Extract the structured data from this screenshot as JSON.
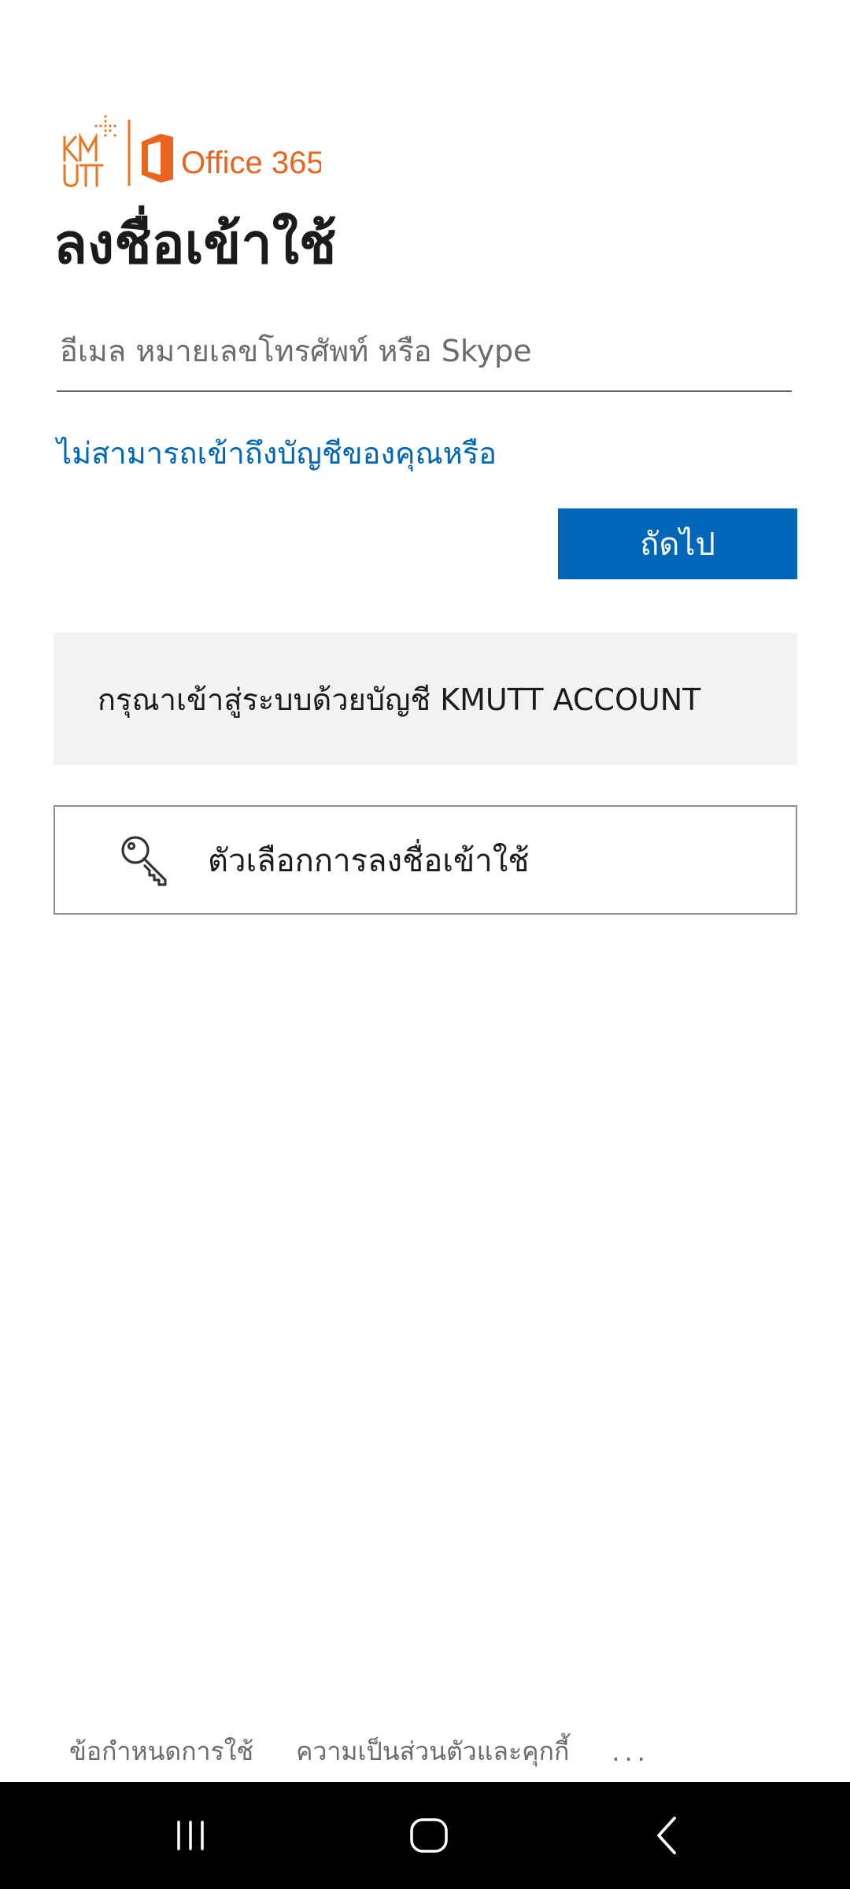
{
  "brand": {
    "logo_text": "KMUTT",
    "product": "Office 365",
    "colors": {
      "brand_orange": "#e87722",
      "accent_blue": "#0067b8"
    }
  },
  "signin": {
    "title": "ลงชื่อเข้าใช้",
    "email_placeholder": "อีเมล หมายเลขโทรศัพท์ หรือ Skype",
    "email_value": "",
    "help_link": "ไม่สามารถเข้าถึงบัญชีของคุณหรือ",
    "next_label": "ถัดไป"
  },
  "notice": {
    "text": "กรุณาเข้าสู่ระบบด้วยบัญชี KMUTT ACCOUNT"
  },
  "signin_options": {
    "label": "ตัวเลือกการลงชื่อเข้าใช้",
    "icon": "key-icon"
  },
  "footer": {
    "terms": "ข้อกำหนดการใช้",
    "privacy": "ความเป็นส่วนตัวและคุกกี้",
    "more": "..."
  },
  "navbar": {
    "icons": [
      "recent-apps-icon",
      "home-icon",
      "back-icon"
    ]
  }
}
